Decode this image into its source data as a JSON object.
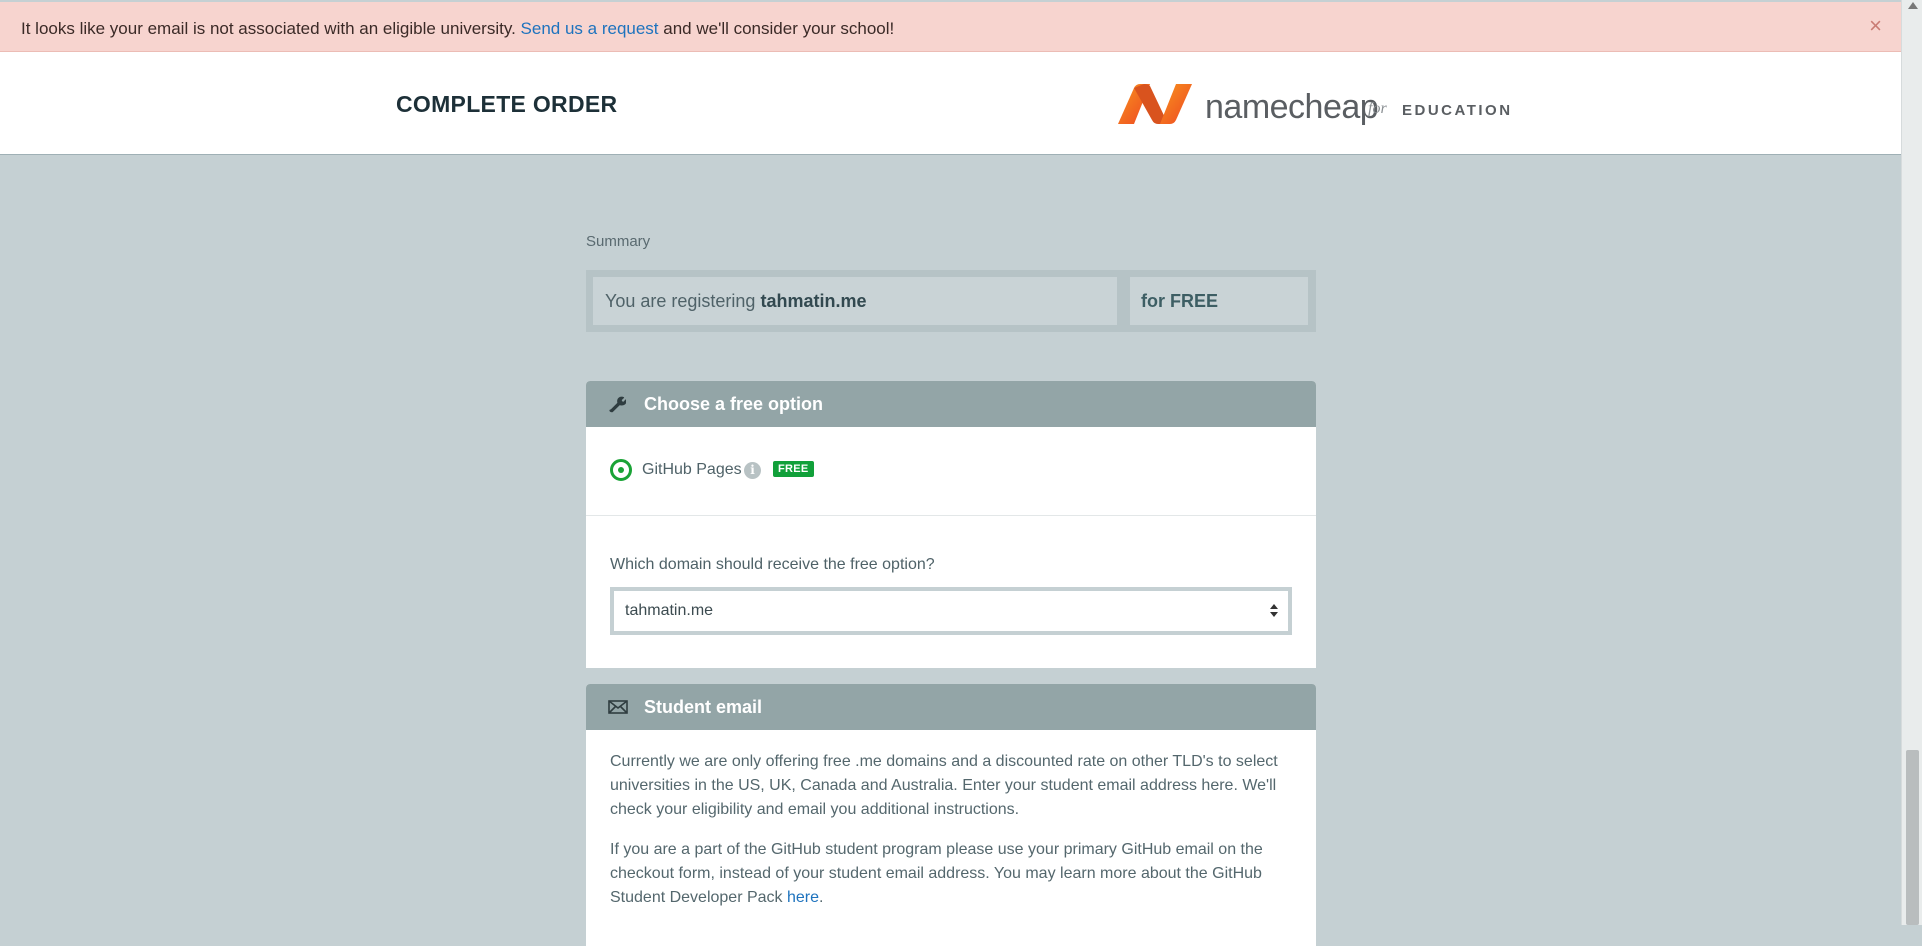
{
  "alert": {
    "text_before": "It looks like your email is not associated with an eligible university.",
    "link": "Send us a request",
    "text_after": "and we'll consider your school!",
    "close": "×"
  },
  "header": {
    "title": "COMPLETE ORDER",
    "logo_word": "namecheap",
    "logo_for": "for",
    "logo_edu": "EDUCATION"
  },
  "summary": {
    "label": "Summary",
    "registering_prefix": "You are registering",
    "domain": "tahmatin.me",
    "price": "for FREE"
  },
  "free_option": {
    "title": "Choose a free option",
    "icon": "wrench-icon",
    "option_label": "GitHub Pages",
    "info": "i",
    "badge": "FREE",
    "select_label": "Which domain should receive the free option?",
    "select_value": "tahmatin.me"
  },
  "student_email": {
    "title": "Student email",
    "icon": "envelope-icon",
    "paragraph1": "Currently we are only offering free .me domains and a discounted rate on other TLD's to select universities in the US, UK, Canada and Australia. Enter your student email address here. We'll check your eligibility and email you additional instructions.",
    "paragraph2_before": "If you are a part of the GitHub student program please use your primary GitHub email on the checkout form, instead of your student email address. You may learn more about the GitHub Student Developer Pack",
    "paragraph2_link": "here",
    "paragraph2_after": "."
  },
  "colors": {
    "page_bg": "#c5d0d3",
    "alert_bg": "#f7d4cf",
    "panel_header": "#93a5a7",
    "accent_green": "#1aa336",
    "logo_orange": "#f26522",
    "link_blue": "#1e73be"
  }
}
